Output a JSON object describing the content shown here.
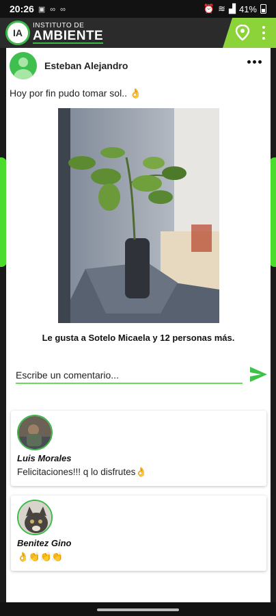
{
  "status": {
    "time": "20:26",
    "notification_icons": "▣ ∞ ∞",
    "battery": "41%"
  },
  "app": {
    "logo_small": "INSTITUTO DE",
    "logo_big": "AMBIENTE",
    "logo_mark": "IA",
    "accent": "#3cb84a",
    "accent_light": "#8cd33a"
  },
  "post": {
    "author": "Esteban Alejandro",
    "text": "Hoy por fin pudo tomar sol.. 👌",
    "likes": "Le gusta a Sotelo Micaela  y 12 personas más."
  },
  "comment_box": {
    "placeholder": "Escribe un comentario..."
  },
  "comments": [
    {
      "name": "Luis Morales",
      "text": "Felicitaciones!!! q lo disfrutes👌"
    },
    {
      "name": "Benitez Gino",
      "text": "👌👏👏👏"
    }
  ]
}
